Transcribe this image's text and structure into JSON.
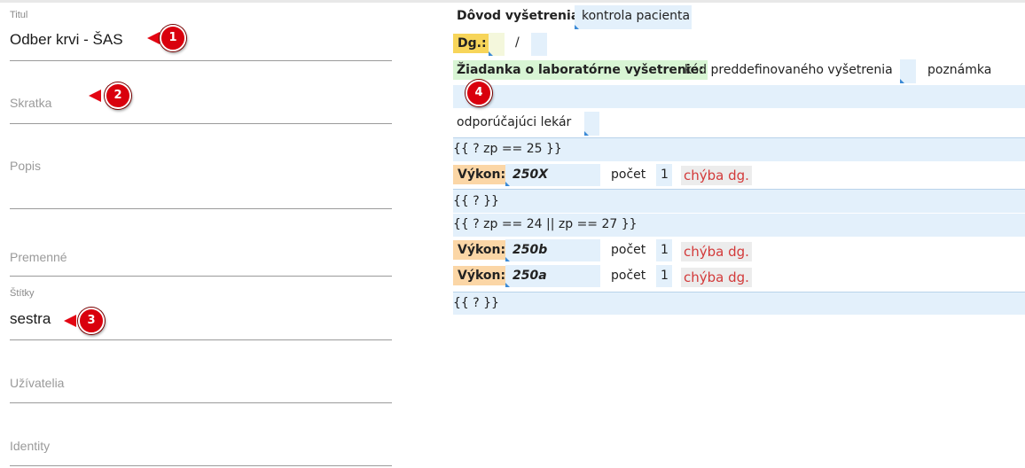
{
  "form": {
    "title": {
      "label": "Titul",
      "value": "Odber krvi - ŠAS"
    },
    "abbreviation": {
      "placeholder": "Skratka"
    },
    "description": {
      "placeholder": "Popis"
    },
    "variables": {
      "placeholder": "Premenné"
    },
    "tags": {
      "label": "Štítky",
      "value": "sestra"
    },
    "users": {
      "placeholder": "Užívatelia"
    },
    "identities": {
      "placeholder": "Identity"
    }
  },
  "markers": [
    "1",
    "2",
    "3",
    "4"
  ],
  "marker_color": "#e30613",
  "template": {
    "reason_label": "Dôvod vyšetrenia:",
    "reason_value": "kontrola pacienta",
    "dg_label": "Dg.:",
    "dg_separator": "/",
    "lab_request_label": "Žiadanka o laboratórne vyšetrenie:",
    "lab_code_text": "kód preddefinovaného vyšetrenia",
    "lab_note_text": "poznámka",
    "referring_doctor_text": "odporúčajúci lekár",
    "conditions": [
      {
        "open": "{{ ? zp == 25 }}",
        "procedures": [
          {
            "label": "Výkon:",
            "code": "250X",
            "count_label": "počet",
            "count": "1",
            "error": "chýba dg."
          }
        ],
        "close": "{{ ? }}"
      },
      {
        "open": "{{ ? zp == 24 || zp == 27 }}",
        "procedures": [
          {
            "label": "Výkon:",
            "code": "250b",
            "count_label": "počet",
            "count": "1",
            "error": "chýba dg."
          },
          {
            "label": "Výkon:",
            "code": "250a",
            "count_label": "počet",
            "count": "1",
            "error": "chýba dg."
          }
        ],
        "close": "{{ ? }}"
      }
    ]
  },
  "colors": {
    "field_box": "#e3f0fb",
    "dg_highlight": "#f7d55a",
    "lab_highlight": "#d8f5d4",
    "procedure_highlight": "#fbd6a6",
    "error_text": "#d33a3a"
  }
}
